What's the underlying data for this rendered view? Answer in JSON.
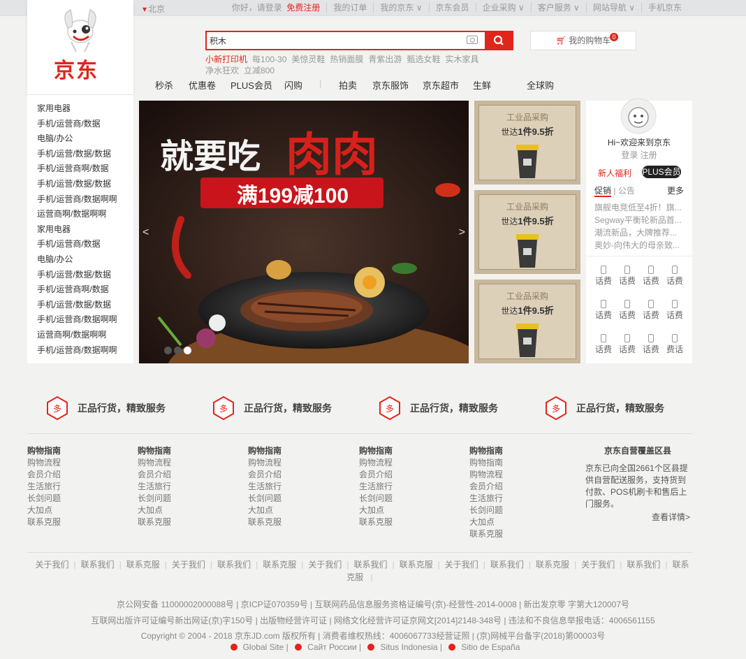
{
  "topbar": {
    "location": "北京",
    "greeting": "你好，请登录",
    "register": "免费注册",
    "items": [
      "我的订单",
      "我的京东",
      "京东会员",
      "企业采购",
      "客户服务",
      "网站导航",
      "手机京东"
    ]
  },
  "logo": {
    "text": "京东"
  },
  "search": {
    "value": "积木"
  },
  "cart": {
    "label": "我的购物车",
    "count": "0"
  },
  "hotwords": {
    "hot": "小新打印机",
    "items": [
      "每100-30",
      "美惊灵鞋",
      "热销面膜",
      "青紫出游",
      "甄选女鞋",
      "实木家具",
      "净水狂欢",
      "立减800"
    ]
  },
  "nav": {
    "items": [
      "秒杀",
      "优惠卷",
      "PLUS会员",
      "闪购",
      "拍卖",
      "京东服饰",
      "京东超市",
      "生鲜",
      "全球购"
    ]
  },
  "sidebar": {
    "items": [
      "家用电器",
      "手机/运营商/数据",
      "电脑/办公",
      "手机/运营/数据/数据",
      "手机/运营商啊/数据",
      "手机/运营/数据/数据",
      "手机/运营商/数据啊啊",
      "运营商啊/数据啊啊",
      "家用电器",
      "手机/运营商/数据",
      "电脑/办公",
      "手机/运营/数据/数据",
      "手机/运营商啊/数据",
      "手机/运营/数据/数据",
      "手机/运营商/数据啊啊",
      "运营商啊/数据啊啊",
      "手机/运营商/数据啊啊"
    ]
  },
  "banner": {
    "headline": "就要吃肉肉",
    "promo": "满199减100",
    "prev": "<",
    "next": ">"
  },
  "ads": [
    {
      "t1": "工业品采购",
      "t2a": "世达",
      "t2b": "1件9.5折"
    },
    {
      "t1": "工业品采购",
      "t2a": "世达",
      "t2b": "1件9.5折"
    },
    {
      "t1": "工业品采购",
      "t2a": "世达",
      "t2b": "1件9.5折"
    }
  ],
  "user": {
    "welcome": "Hi~欢迎来到京东",
    "login": "登录",
    "register": "注册",
    "new_benefit": "新人福利",
    "plus": "PLUS会员",
    "tab_promo": "促销",
    "tab_notice": "公告",
    "more": "更多",
    "news": [
      "旗舰电竞低至4折！旗...",
      "Segway平衡轮新品首...",
      "潮流新品，大牌推荐...",
      "奥妙-向伟大的母亲致..."
    ],
    "services": [
      "话费",
      "话费",
      "话费",
      "话费",
      "话费",
      "话费",
      "话费",
      "话费",
      "话费",
      "话费",
      "话费",
      "费话"
    ]
  },
  "promises": [
    "正品行货，精致服务",
    "正品行货，精致服务",
    "正品行货，精致服务",
    "正品行货，精致服务"
  ],
  "promise_icon_text": "多",
  "footer_cols": [
    {
      "title": "购物指南",
      "items": [
        "购物流程",
        "会员介绍",
        "生活旅行",
        "长剑问题",
        "大加点",
        "联系克服"
      ]
    },
    {
      "title": "购物指南",
      "items": [
        "购物流程",
        "会员介绍",
        "生活旅行",
        "长剑问题",
        "大加点",
        "联系克服"
      ]
    },
    {
      "title": "购物指南",
      "items": [
        "购物流程",
        "会员介绍",
        "生活旅行",
        "长剑问题",
        "大加点",
        "联系克服"
      ]
    },
    {
      "title": "购物指南",
      "items": [
        "购物流程",
        "会员介绍",
        "生活旅行",
        "长剑问题",
        "大加点",
        "联系克服"
      ]
    },
    {
      "title": "购物指南",
      "items": [
        "购物指南",
        "购物流程",
        "会员介绍",
        "生活旅行",
        "长剑问题",
        "大加点",
        "联系克服"
      ]
    }
  ],
  "coverage": {
    "title": "京东自营覆盖区县",
    "text": "京东已向全国2661个区县提供自营配送服务，支持货到付款、POS机刷卡和售后上门服务。",
    "more": "查看详情>"
  },
  "links": [
    "关于我们",
    "联系我们",
    "联系克服",
    "关于我们",
    "联系我们",
    "联系克服",
    "关于我们",
    "联系我们",
    "联系克服",
    "关于我们",
    "联系我们",
    "联系克服",
    "关于我们",
    "联系我们",
    "联系克服"
  ],
  "copyright": [
    "京公网安备 11000002000088号 | 京ICP证070359号 | 互联网药品信息服务资格证编号(京)-经营性-2014-0008 | 新出发京零 字第大120007号",
    "互联网出版许可证编号新出网证(京)字150号 | 出版物经营许可证 | 网络文化经营许可证京网文[2014]2148-348号 | 违法和不良信息举报电话：4006561155",
    "Copyright © 2004 - 2018 京东JD.com 版权所有 | 消费者维权热线：4006067733经营证照 | (京)网械平台备字(2018)第00003号"
  ],
  "intl": [
    "Global Site",
    "Сайт России",
    "Situs Indonesia",
    "Sitio de España"
  ],
  "colors": {
    "brand": "#e1251b",
    "background": "#f2f2f0"
  }
}
